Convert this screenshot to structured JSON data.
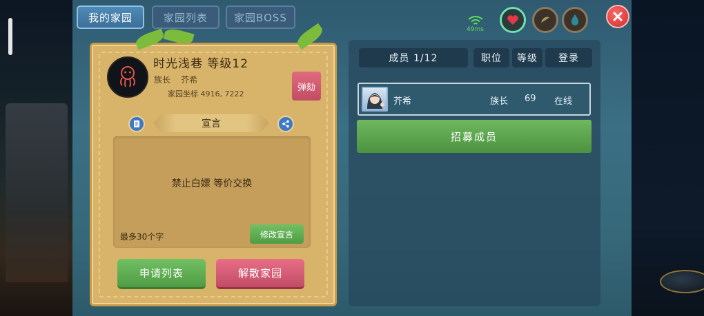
{
  "tabs": [
    {
      "label": "我的家园",
      "active": true
    },
    {
      "label": "家园列表",
      "active": false
    },
    {
      "label": "家园BOSS",
      "active": false
    }
  ],
  "hud": {
    "ping": "49ms",
    "icons": [
      "wifi-icon",
      "heart-icon",
      "hunger-icon",
      "water-icon",
      "close-icon"
    ]
  },
  "family": {
    "title": "时光浅巷 等级12",
    "leader_label": "族长",
    "leader_name": "芥希",
    "coord_label": "家园坐标",
    "coord_value": "4916, 7222",
    "impeach_button": "弹劾",
    "emblem": "octopus-icon"
  },
  "declaration": {
    "header": "宣言",
    "text": "禁止白嫖 等价交换",
    "max_hint": "最多30个字",
    "modify_button": "修改宣言"
  },
  "actions": {
    "apply_list": "申请列表",
    "disband": "解散家园"
  },
  "members": {
    "headers": [
      "成员 1/12",
      "职位",
      "等级",
      "登录"
    ],
    "rows": [
      {
        "name": "芥希",
        "role": "族长",
        "level": "69",
        "status": "在线"
      }
    ],
    "recruit_button": "招募成员"
  },
  "colors": {
    "accent_green": "#5ea94e",
    "accent_red": "#d2566e",
    "parchment": "#d8b46a",
    "tab_active": "#4f8bb8"
  }
}
